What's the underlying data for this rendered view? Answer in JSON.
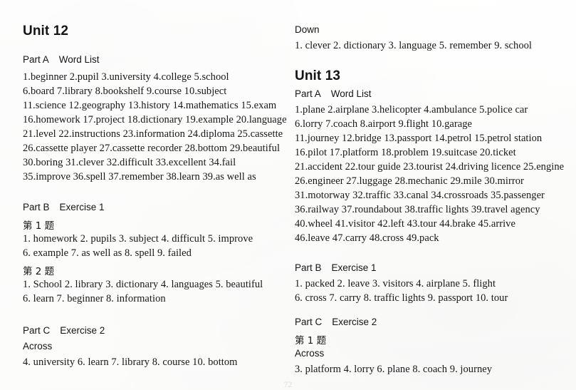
{
  "document": {
    "page_number": "72",
    "left_column": {
      "unit_title": "Unit 12",
      "part_a": {
        "part_label": "Part A",
        "section_label": "Word List"
      },
      "word_list_lines": [
        "1.beginner   2.pupil   3.university   4.college   5.school",
        "6.board   7.library   8.bookshelf   9.course   10.subject",
        "11.science   12.geography   13.history   14.mathematics   15.exam",
        "16.homework   17.project   18.dictionary   19.example   20.language",
        "21.level   22.instructions   23.information   24.diploma   25.cassette",
        "26.cassette player   27.cassette recorder   28.bottom   29.beautiful",
        "30.boring   31.clever   32.difficult   33.excellent   34.fail",
        "35.improve   36.spell   37.remember   38.learn   39.as well as"
      ],
      "part_b": {
        "part_label": "Part B",
        "section_label": "Exercise 1"
      },
      "exercise1": {
        "q1_label": "第 1 题",
        "q1_lines": [
          "1. homework   2. pupils   3. subject   4. difficult   5. improve",
          "6. example   7. as well as   8. spell   9. failed"
        ],
        "q2_label": "第 2 题",
        "q2_lines": [
          "1. School   2. library   3. dictionary   4. languages   5. beautiful",
          "6. learn   7. beginner   8. information"
        ]
      },
      "part_c": {
        "part_label": "Part C",
        "section_label": "Exercise 2"
      },
      "exercise2": {
        "across_label": "Across",
        "across_lines": [
          "4. university   6. learn   7. library   8. course   10. bottom"
        ]
      }
    },
    "right_column": {
      "unit12_continued": {
        "down_label": "Down",
        "down_lines": [
          "1. clever   2. dictionary   3. language   5. remember   9. school"
        ]
      },
      "unit_title": "Unit 13",
      "part_a": {
        "part_label": "Part A",
        "section_label": "Word List"
      },
      "word_list_lines": [
        "1.plane   2.airplane   3.helicopter   4.ambulance   5.police car",
        "6.lorry   7.coach   8.airport   9.flight   10.garage",
        "11.journey   12.bridge   13.passport   14.petrol   15.petrol station",
        "16.pilot   17.platform   18.problem   19.suitcase   20.ticket",
        "21.accident   22.tour guide   23.tourist   24.driving licence   25.engine",
        "26.engineer   27.luggage   28.mechanic   29.mile   30.mirror",
        "31.motorway   32.traffic   33.canal   34.crossroads   35.passenger",
        "36.railway   37.roundabout   38.traffic lights   39.travel agency",
        "40.wheel   41.visitor   42.left   43.tour   44.brake   45.arrive",
        "46.leave   47.carry   48.cross   49.pack"
      ],
      "part_b": {
        "part_label": "Part B",
        "section_label": "Exercise 1"
      },
      "exercise1": {
        "lines": [
          "1. packed   2. leave   3. visitors   4. airplane   5. flight",
          "6. cross   7. carry   8. traffic lights   9. passport   10. tour"
        ]
      },
      "part_c": {
        "part_label": "Part C",
        "section_label": "Exercise 2"
      },
      "exercise2": {
        "q1_label": "第 1 题",
        "across_label": "Across",
        "across_lines": [
          "3. platform   4. lorry   6. plane   8. coach   9. journey"
        ]
      }
    }
  }
}
